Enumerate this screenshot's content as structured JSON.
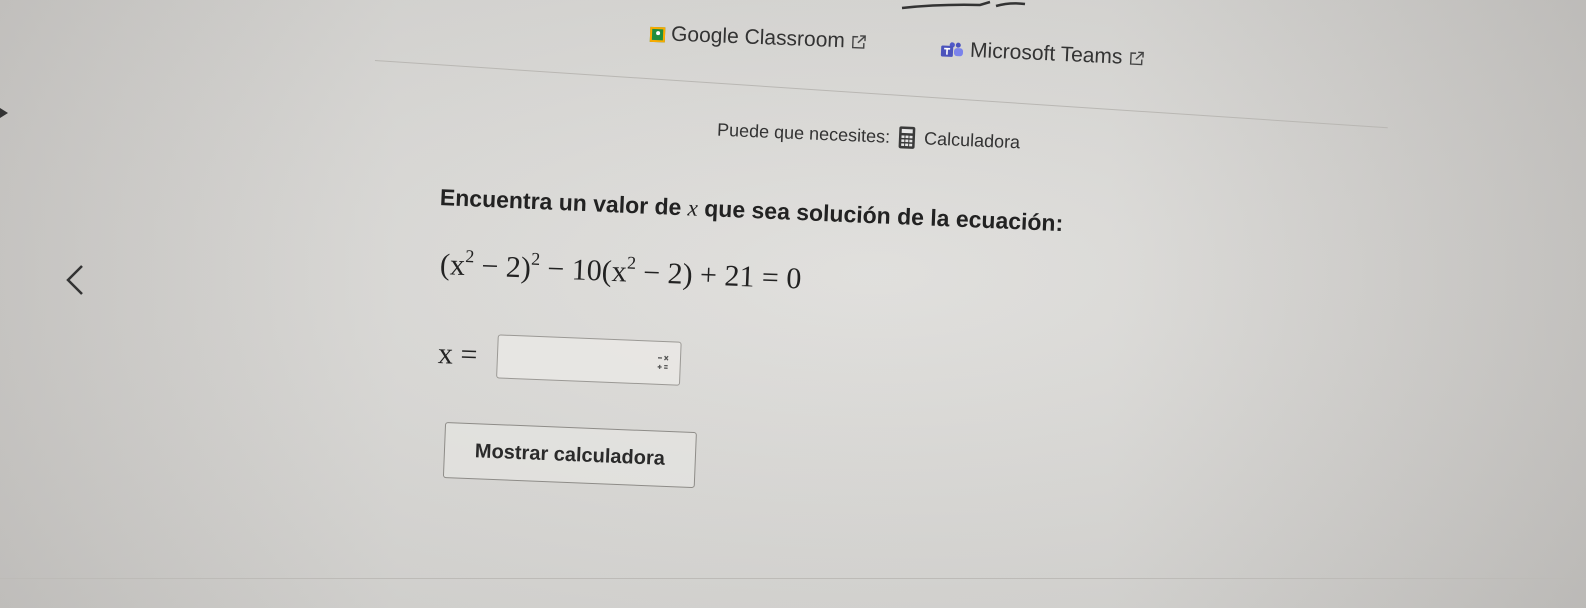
{
  "links": {
    "classroom": {
      "label": "Google Classroom",
      "icon": "google-classroom-logo"
    },
    "teams": {
      "label": "Microsoft Teams",
      "icon": "microsoft-teams-logo"
    }
  },
  "tools": {
    "intro": "Puede que necesites:",
    "calculator_label": "Calculadora",
    "calculator_icon": "calculator-icon"
  },
  "question": {
    "prompt_before": "Encuentra un valor de",
    "variable": "x",
    "prompt_after": "que sea solución de la ecuación:",
    "equation": {
      "open": "(x",
      "exp1": "2",
      "mid": " − 2)",
      "exp2": "2",
      "part2": " − 10(x",
      "exp3": "2",
      "part3": " − 2) + 21 = 0"
    }
  },
  "answer": {
    "label": "x =",
    "value": "",
    "keypad_icon": "math-keypad-icon"
  },
  "buttons": {
    "show_calculator": "Mostrar calculadora",
    "previous_icon": "chevron-left-icon"
  },
  "colors": {
    "text": "#2b2b2b",
    "classroom_green": "#1e8e3e",
    "teams_purple": "#4b53bc",
    "border": "#9b9995"
  }
}
